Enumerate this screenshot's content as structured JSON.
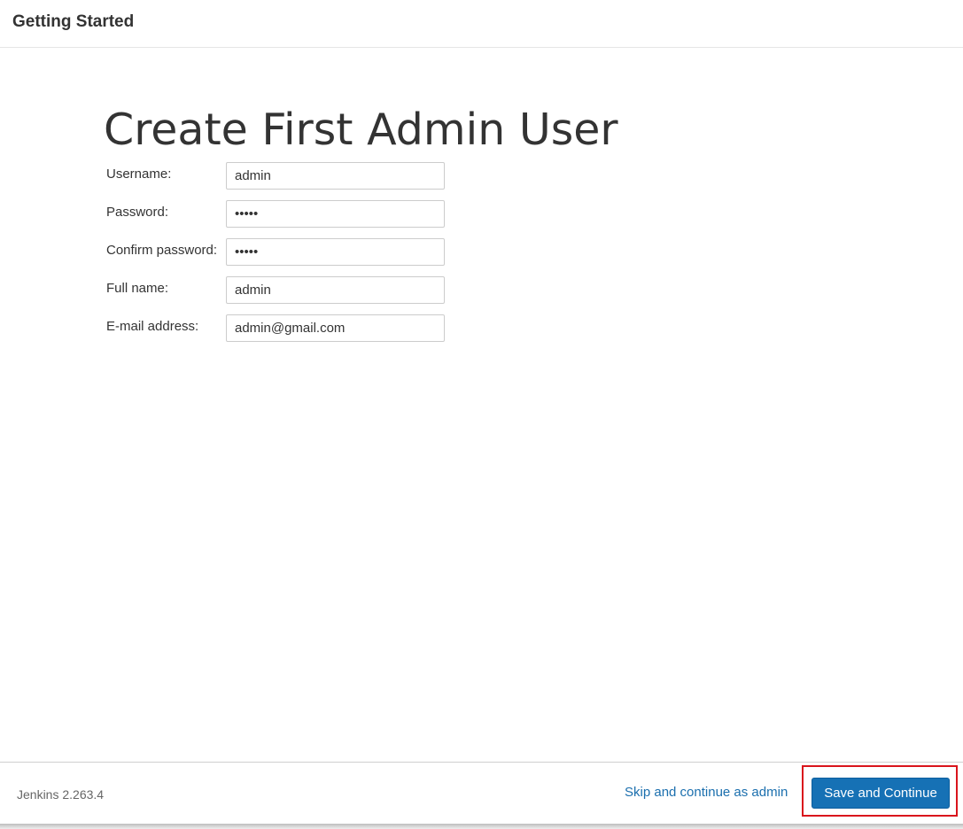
{
  "header": {
    "title": "Getting Started"
  },
  "main": {
    "title": "Create First Admin User",
    "fields": [
      {
        "label": "Username:",
        "value": "admin",
        "type": "text"
      },
      {
        "label": "Password:",
        "value": "admin",
        "type": "password"
      },
      {
        "label": "Confirm password:",
        "value": "admin",
        "type": "password"
      },
      {
        "label": "Full name:",
        "value": "admin",
        "type": "text"
      },
      {
        "label": "E-mail address:",
        "value": "admin@gmail.com",
        "type": "text"
      }
    ]
  },
  "footer": {
    "version": "Jenkins 2.263.4",
    "skip_label": "Skip and continue as admin",
    "save_label": "Save and Continue"
  },
  "colors": {
    "primary_button": "#1671b5",
    "link": "#1b6fae",
    "highlight": "#d9141c"
  }
}
